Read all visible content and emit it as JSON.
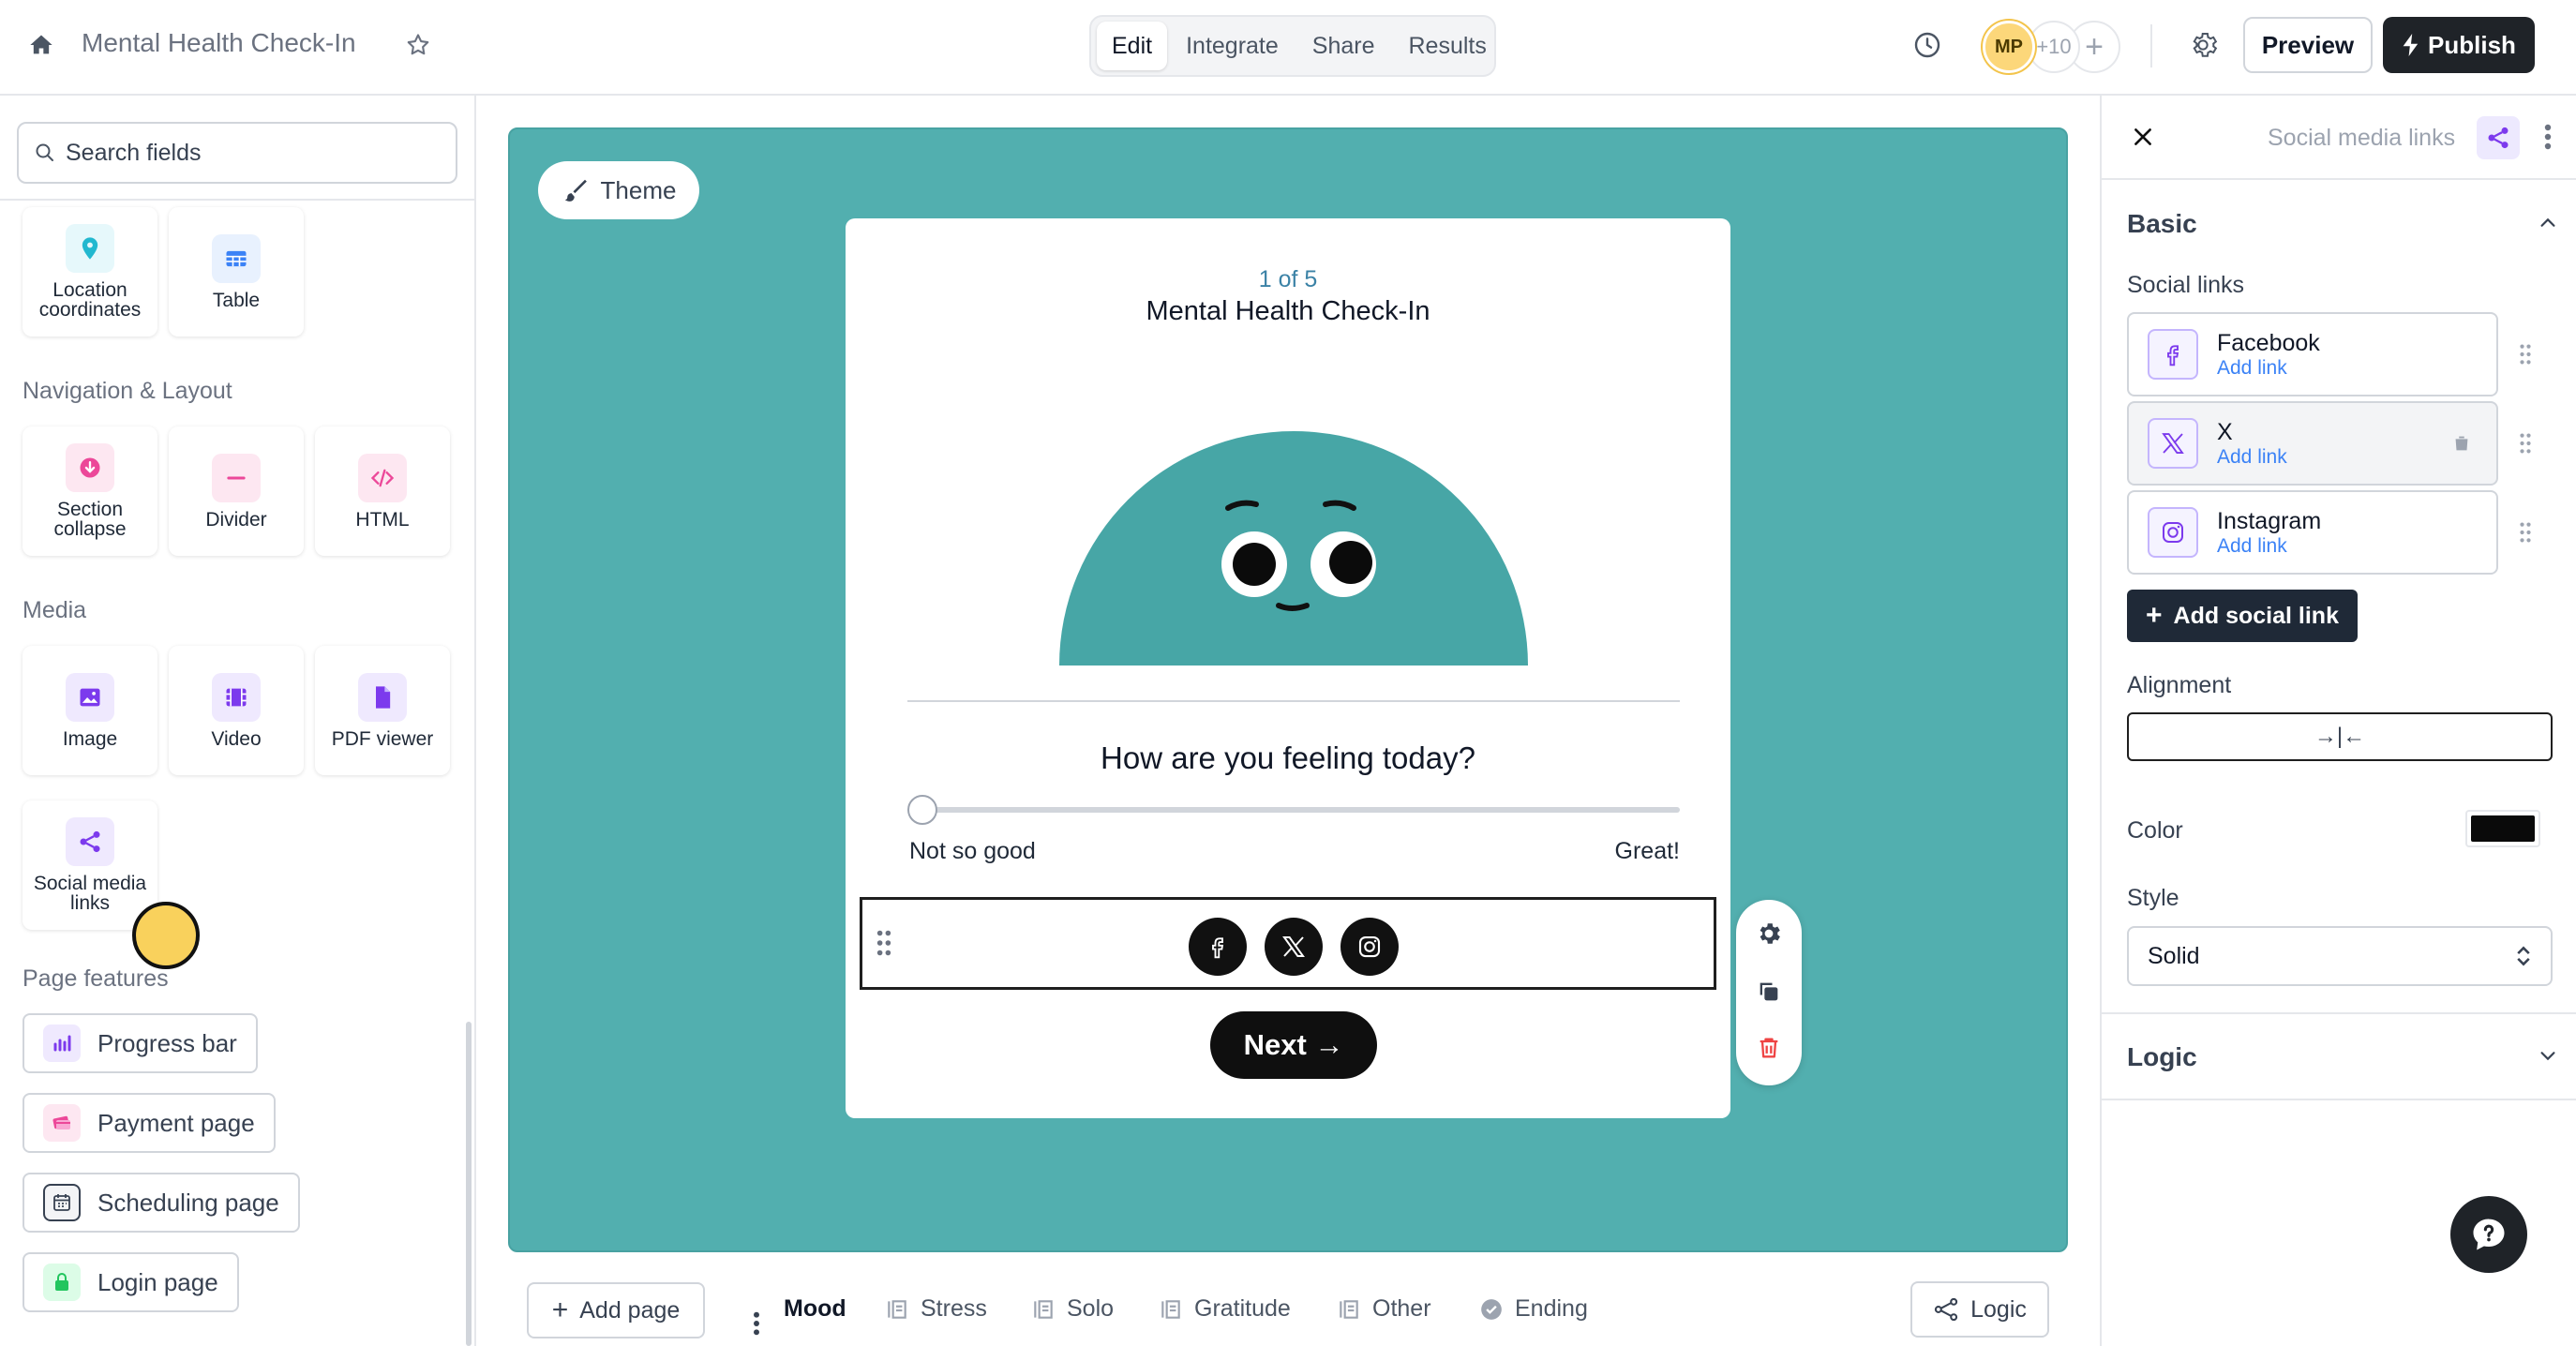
{
  "topbar": {
    "title": "Mental Health Check-In",
    "tabs": [
      "Edit",
      "Integrate",
      "Share",
      "Results"
    ],
    "active_tab": "Edit",
    "avatar_initials": "MP",
    "avatar_more": "+10",
    "preview_label": "Preview",
    "publish_label": "Publish"
  },
  "left": {
    "search_placeholder": "Search fields",
    "fields_top": [
      {
        "label": "Location coordinates",
        "icon": "location-pin-icon",
        "color": "#22b8cf"
      },
      {
        "label": "Table",
        "icon": "table-icon",
        "color": "#3b82f6"
      }
    ],
    "sections": {
      "navigation": "Navigation & Layout",
      "media": "Media",
      "page_features": "Page features"
    },
    "navigation_items": [
      {
        "label": "Section collapse",
        "icon": "section-collapse-icon",
        "color": "#ec4899"
      },
      {
        "label": "Divider",
        "icon": "divider-icon",
        "color": "#ec4899"
      },
      {
        "label": "HTML",
        "icon": "html-code-icon",
        "color": "#ec4899"
      }
    ],
    "media_items": [
      {
        "label": "Image",
        "icon": "image-icon",
        "color": "#7c3aed"
      },
      {
        "label": "Video",
        "icon": "video-icon",
        "color": "#7c3aed"
      },
      {
        "label": "PDF viewer",
        "icon": "pdf-file-icon",
        "color": "#7c3aed"
      },
      {
        "label": "Social media links",
        "icon": "share-nodes-icon",
        "color": "#7c3aed"
      }
    ],
    "page_features": [
      {
        "label": "Progress bar",
        "icon": "bar-chart-icon",
        "color": "#7c3aed"
      },
      {
        "label": "Payment page",
        "icon": "payment-card-icon",
        "color": "#ec4899"
      },
      {
        "label": "Scheduling page",
        "icon": "calendar-icon",
        "color": "#374151"
      },
      {
        "label": "Login page",
        "icon": "lock-icon",
        "color": "#22c55e"
      }
    ]
  },
  "canvas": {
    "bg_color": "#52afaf",
    "theme_label": "Theme",
    "page_count": "1 of 5",
    "form_title": "Mental Health Check-In",
    "question": "How are you feeling today?",
    "slider_min_label": "Not so good",
    "slider_max_label": "Great!",
    "slider_value": 0,
    "social_icons": [
      "facebook-icon",
      "x-icon",
      "instagram-icon"
    ],
    "next_label": "Next →"
  },
  "bottom": {
    "add_page_label": "Add page",
    "pages": [
      {
        "label": "Mood",
        "active": true
      },
      {
        "label": "Stress"
      },
      {
        "label": "Solo"
      },
      {
        "label": "Gratitude"
      },
      {
        "label": "Other"
      },
      {
        "label": "Ending"
      }
    ],
    "logic_label": "Logic"
  },
  "right": {
    "title": "Social media links",
    "basic_label": "Basic",
    "social_links_label": "Social links",
    "links": [
      {
        "name": "Facebook",
        "action": "Add link"
      },
      {
        "name": "X",
        "action": "Add link"
      },
      {
        "name": "Instagram",
        "action": "Add link"
      }
    ],
    "add_social_label": "Add social link",
    "alignment_label": "Alignment",
    "alignment_glyph": "→|←",
    "color_label": "Color",
    "color_value": "#0a0a0a",
    "style_label": "Style",
    "style_value": "Solid",
    "logic_label": "Logic"
  }
}
